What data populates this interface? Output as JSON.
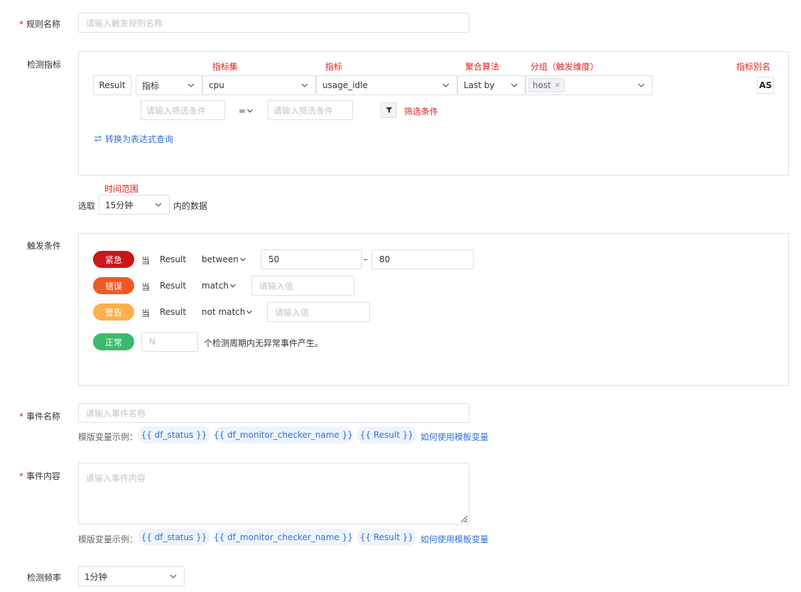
{
  "rule_name": {
    "label": "规则名称",
    "placeholder": "请输入触发规则名称"
  },
  "detect_metric": {
    "label": "检测指标",
    "annotations": {
      "metric_set": "指标集",
      "metric": "指标",
      "aggregation": "聚合算法",
      "group": "分组（触发维度）",
      "alias": "指标别名",
      "filter": "筛选条件",
      "time_range": "时间范围"
    },
    "result_label": "Result",
    "type_select": "指标",
    "metric_set_select": "cpu",
    "metric_select": "usage_idle",
    "agg_select": "Last by",
    "group_tag": "host",
    "alias_button": "AS",
    "filter_key_placeholder": "请输入筛选条件",
    "filter_op": "=",
    "filter_value_placeholder": "请输入筛选条件",
    "convert_link": "转换为表达式查询"
  },
  "time_range": {
    "prefix": "选取",
    "value": "15分钟",
    "suffix": "内的数据"
  },
  "trigger": {
    "label": "触发条件",
    "when": "当",
    "rows": [
      {
        "level": "紧急",
        "color": "#c9171c",
        "target": "Result",
        "op": "between",
        "v1": "50",
        "sep": "–",
        "v2": "80"
      },
      {
        "level": "错误",
        "color": "#ee5a24",
        "target": "Result",
        "op": "match",
        "placeholder": "请输入值"
      },
      {
        "level": "警告",
        "color": "#fcb04b",
        "target": "Result",
        "op": "not match",
        "placeholder": "请输入值"
      }
    ],
    "normal": {
      "level": "正常",
      "color": "#3dba6d",
      "placeholder": "N",
      "suffix": "个检测周期内无异常事件产生。"
    }
  },
  "event_name": {
    "label": "事件名称",
    "placeholder": "请输入事件名称"
  },
  "event_content": {
    "label": "事件内容",
    "placeholder": "请输入事件内容"
  },
  "template_vars": {
    "label": "模版变量示例：",
    "vars": [
      "{{ df_status }}",
      "{{ df_monitor_checker_name }}",
      "{{ Result }}"
    ],
    "help_link": "如何使用模板变量"
  },
  "frequency": {
    "label": "检测频率",
    "value": "1分钟"
  },
  "required_mark": "*",
  "icons": {
    "chevron": "chevron-down-icon",
    "filter": "filter-icon",
    "swap": "swap-icon",
    "close": "close-icon",
    "resize": "resize-handle-icon"
  }
}
